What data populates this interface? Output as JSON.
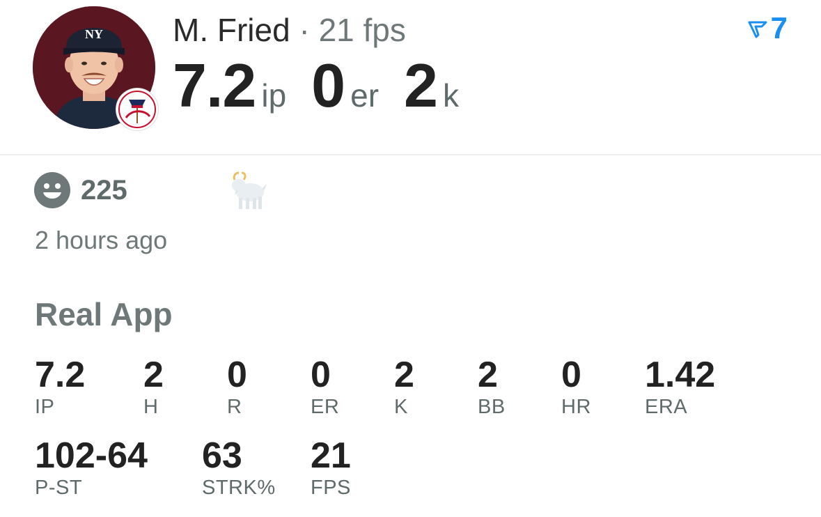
{
  "player": {
    "name": "M. Fried",
    "separator": "·",
    "fps_label": "21 fps",
    "avatar_icon": "player-avatar",
    "team_logo_icon": "yankees-logo"
  },
  "header_stats": [
    {
      "value": "7.2",
      "unit": "ip"
    },
    {
      "value": "0",
      "unit": "er"
    },
    {
      "value": "2",
      "unit": "k"
    }
  ],
  "brand": {
    "icon": "real-app-logo-icon",
    "count": "7",
    "color": "#1a8ff0"
  },
  "reactions": {
    "icon": "smiley-icon",
    "count": "225",
    "goat_icon": "goat-icon"
  },
  "timestamp": "2 hours ago",
  "section": {
    "title": "Real App"
  },
  "stats_row1": [
    {
      "value": "7.2",
      "label": "IP"
    },
    {
      "value": "2",
      "label": "H"
    },
    {
      "value": "0",
      "label": "R"
    },
    {
      "value": "0",
      "label": "ER"
    },
    {
      "value": "2",
      "label": "K"
    },
    {
      "value": "2",
      "label": "BB"
    },
    {
      "value": "0",
      "label": "HR"
    },
    {
      "value": "1.42",
      "label": "ERA"
    }
  ],
  "stats_row2": [
    {
      "value": "102-64",
      "label": "P-ST"
    },
    {
      "value": "63",
      "label": "STRK%"
    },
    {
      "value": "21",
      "label": "FPS"
    }
  ]
}
